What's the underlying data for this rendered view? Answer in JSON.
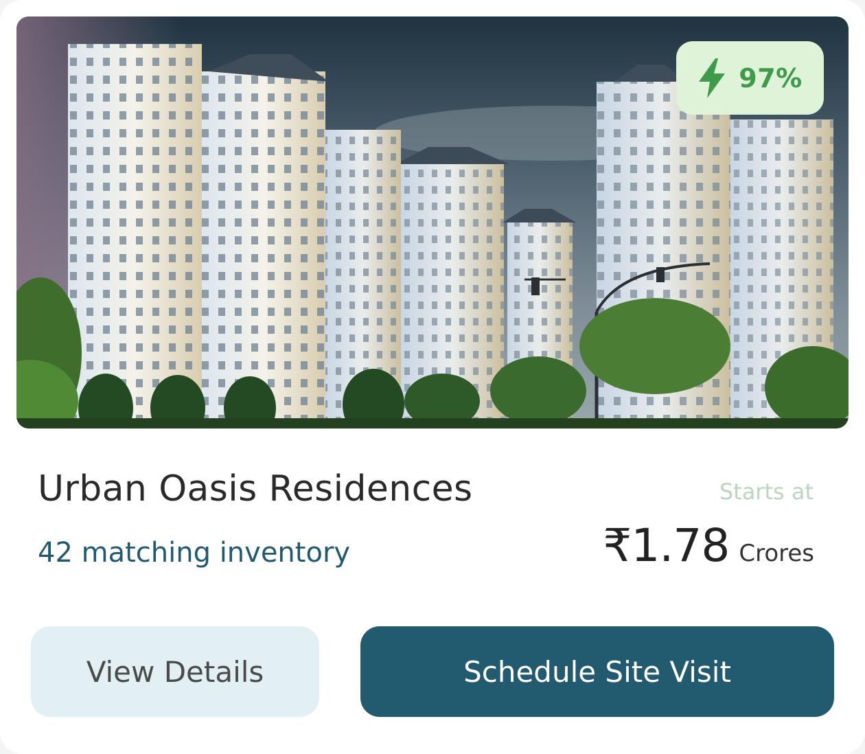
{
  "property": {
    "name": "Urban Oasis Residences",
    "inventory": "42 matching inventory",
    "match_badge": {
      "icon": "lightning-bolt-icon",
      "percent": "97%",
      "color": "#3f9a4a"
    }
  },
  "pricing": {
    "label": "Starts at",
    "amount": "₹1.78",
    "unit": "Crores"
  },
  "actions": {
    "view_details": "View Details",
    "schedule_visit": "Schedule Site Visit"
  },
  "colors": {
    "primary": "#225a70",
    "secondary_bg": "#e2eff3",
    "badge_bg": "#dff3d8"
  }
}
